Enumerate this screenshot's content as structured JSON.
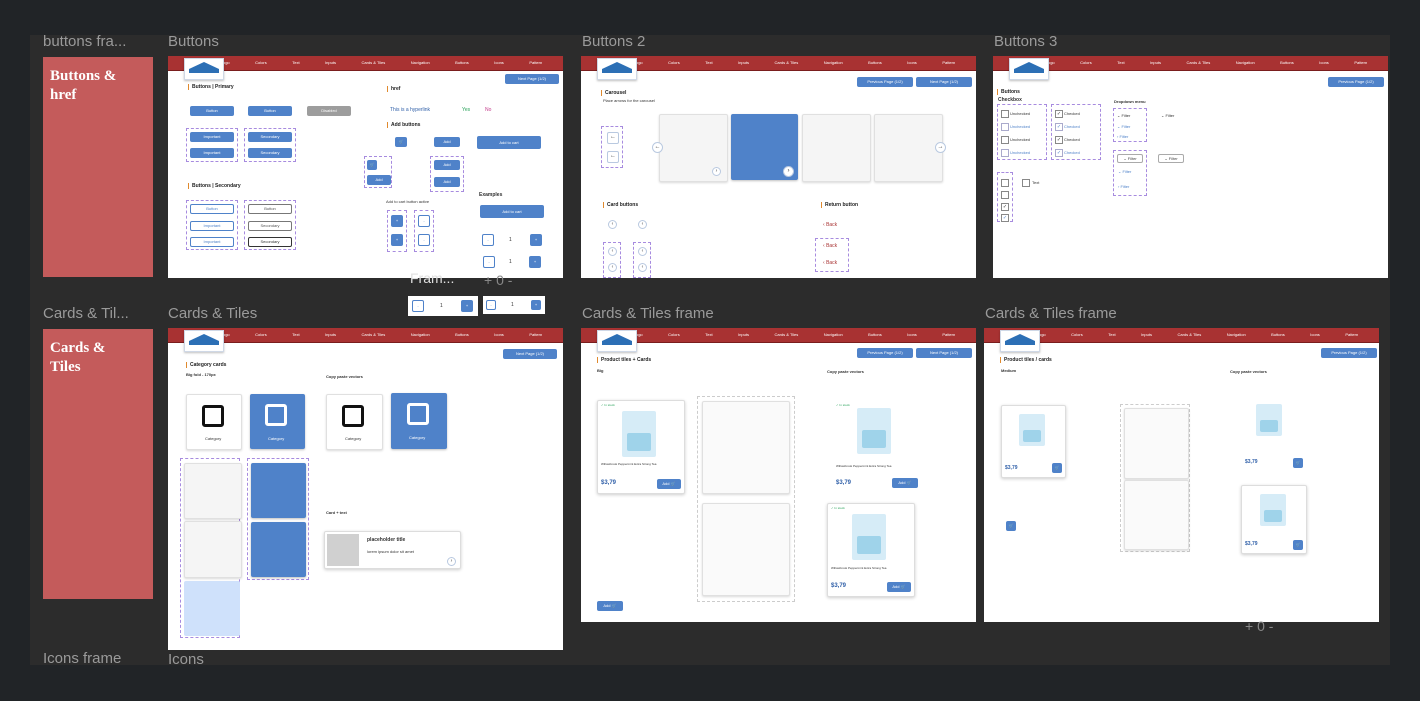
{
  "labels": {
    "buttons_frame": "buttons fra...",
    "buttons": "Buttons",
    "buttons2": "Buttons 2",
    "buttons3": "Buttons 3",
    "cards_tiles_left": "Cards & Til...",
    "cards_tiles": "Cards & Tiles",
    "cards_tiles_frame1": "Cards & Tiles frame",
    "cards_tiles_frame2": "Cards & Tiles frame",
    "icons_frame": "Icons frame",
    "icons": "Icons",
    "frame_trunc": "Fram...",
    "zoom_mark": "+ 0 -",
    "zoom_mark2": "+ 0 -"
  },
  "sections": {
    "buttons_href": "Buttons & href",
    "cards_tiles": "Cards & Tiles"
  },
  "nav": {
    "items": [
      "Logo",
      "Colors",
      "Text",
      "Inputs",
      "Cards & Tiles",
      "Navigation",
      "Buttons",
      "Icons",
      "Pattern"
    ]
  },
  "frames": {
    "buttons": {
      "primary_title": "Buttons | Primary",
      "secondary_title": "Buttons | Secondary",
      "href_title": "href",
      "href_text": "This is a hyperlink",
      "link_yes": "Yes",
      "link_no": "No",
      "add_buttons_title": "Add buttons",
      "next_page": "Next Page (1/2)",
      "button": "Button",
      "disabled": "Disabled",
      "important": "Important",
      "secondary": "Secondary",
      "add": "Add",
      "add_to_cart": "Add to cart",
      "add_to_cart_row": "Add to cart button active",
      "examples": "Examples",
      "qty": "1",
      "minus": "-",
      "plus": "+"
    },
    "buttons2": {
      "carousel_title": "Carousel",
      "carousel_desc": "Place arrows for the carousel",
      "card_buttons_title": "Card buttons",
      "return_title": "Return button",
      "back": "Back",
      "prev_page": "Previous Page (1/2)",
      "next_page": "Next Page (1/2)"
    },
    "buttons3": {
      "buttons_title": "Buttons",
      "checkbox": "Checkbox",
      "dropdown": "Dropdown menu",
      "unchecked": "Unchecked",
      "checked": "Checked",
      "filter": "Filter",
      "text": "Text",
      "prev_page": "Previous Page (1/2)"
    },
    "cards": {
      "category_title": "Category cards",
      "category_label": "Category",
      "copy_title": "Copy paste vectors",
      "card_text": "Card + text",
      "placeholder_title": "placeholder title",
      "placeholder_desc": "lorem ipsum dolor sit amet",
      "next_page": "Next Page (1/2)",
      "size_label": "Big fold - 170px"
    },
    "product": {
      "title": "Product tiles + Cards",
      "big": "Big",
      "copy_title": "Copy paste vectors",
      "in_stock": "In stock",
      "product_name": "Willowbrook Peppermint Extra Strong Tea",
      "price": "$3,79",
      "add": "Add",
      "prev_page": "Previous Page (1/2)",
      "next_page": "Next Page (1/2)"
    },
    "product2": {
      "title": "Product tiles / cards",
      "medium": "Medium",
      "copy_title": "Copy paste vectors",
      "price": "$3,79",
      "prev_page": "Previous Page (1/2)"
    },
    "floating": {
      "qty": "1"
    }
  }
}
